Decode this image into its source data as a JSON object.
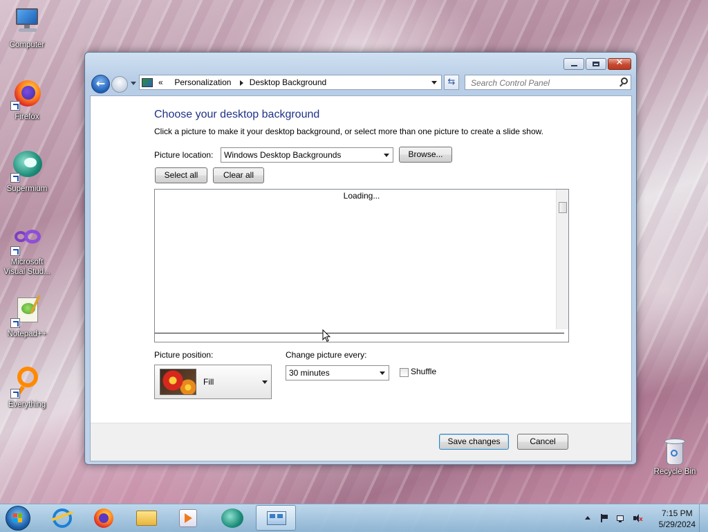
{
  "desktop": {
    "icons": [
      {
        "label": "Computer",
        "icon": "computer-icon"
      },
      {
        "label": "Firefox",
        "icon": "firefox-icon"
      },
      {
        "label": "Supermium",
        "icon": "supermium-icon"
      },
      {
        "label": "Microsoft Visual Stud...",
        "icon": "visual-studio-icon"
      },
      {
        "label": "Notepad++",
        "icon": "notepad-plus-plus-icon"
      },
      {
        "label": "Everything",
        "icon": "everything-icon"
      }
    ],
    "recycle_bin": "Recycle Bin"
  },
  "window": {
    "address": {
      "overflow": "«",
      "crumbs": [
        "Personalization",
        "Desktop Background"
      ]
    },
    "search_placeholder": "Search Control Panel",
    "heading": "Choose your desktop background",
    "intro": "Click a picture to make it your desktop background, or select more than one picture to create a slide show.",
    "picture_location_label": "Picture location:",
    "picture_location_value": "Windows Desktop Backgrounds",
    "browse_label": "Browse...",
    "select_all_label": "Select all",
    "clear_all_label": "Clear all",
    "loading_text": "Loading...",
    "picture_position_label": "Picture position:",
    "picture_position_value": "Fill",
    "change_every_label": "Change picture every:",
    "change_every_value": "30 minutes",
    "shuffle_label": "Shuffle",
    "shuffle_checked": false,
    "save_label": "Save changes",
    "cancel_label": "Cancel"
  },
  "taskbar": {
    "items": [
      "internet-explorer-icon",
      "firefox-icon",
      "file-explorer-icon",
      "media-player-icon",
      "supermium-icon",
      "control-panel-icon"
    ],
    "time": "7:15 PM",
    "date": "5/29/2024"
  },
  "colors": {
    "heading": "#1e3287",
    "window_frame": "#bfd2e8",
    "taskbar": "#a9cbe3"
  }
}
